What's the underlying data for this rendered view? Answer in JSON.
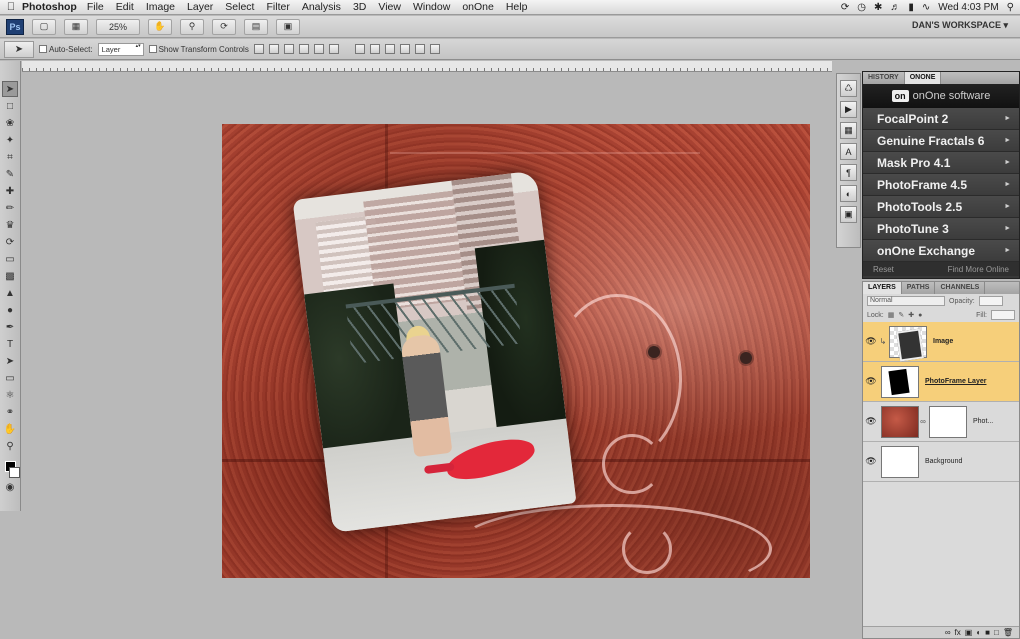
{
  "menubar": {
    "app_name": "Photoshop",
    "items": [
      "File",
      "Edit",
      "Image",
      "Layer",
      "Select",
      "Filter",
      "Analysis",
      "3D",
      "View",
      "Window",
      "onOne",
      "Help"
    ],
    "clock": "Wed 4:03 PM"
  },
  "appbar": {
    "logo": "Ps",
    "zoom": "25%",
    "workspace": "DAN'S WORKSPACE ▾"
  },
  "options": {
    "auto_select_label": "Auto-Select:",
    "auto_select_value": "Layer",
    "show_transform_label": "Show Transform Controls"
  },
  "onone_panel": {
    "tabs": [
      "HISTORY",
      "ONONE"
    ],
    "logo_mark": "on",
    "logo_text": "onOne software",
    "items": [
      {
        "label": "FocalPoint 2"
      },
      {
        "label": "Genuine Fractals 6"
      },
      {
        "label": "Mask Pro 4.1"
      },
      {
        "label": "PhotoFrame 4.5"
      },
      {
        "label": "PhotoTools 2.5"
      },
      {
        "label": "PhotoTune 3"
      },
      {
        "label": "onOne Exchange"
      }
    ],
    "footer_left": "Reset",
    "footer_right": "Find More Online"
  },
  "layers_panel": {
    "tabs": [
      "LAYERS",
      "PATHS",
      "CHANNELS"
    ],
    "blend_mode": "Normal",
    "opacity_label": "Opacity:",
    "lock_label": "Lock:",
    "fill_label": "Fill:",
    "layers": [
      {
        "name": "Image",
        "selected": true
      },
      {
        "name": "PhotoFrame Layer",
        "selected": true
      },
      {
        "name": "Phot...",
        "selected": false
      },
      {
        "name": "Background",
        "selected": false
      }
    ]
  },
  "colors": {
    "selected_layer": "#f6cf7a",
    "onone_panel_bg": "#383838",
    "canvas_rust": "#a9473a"
  }
}
